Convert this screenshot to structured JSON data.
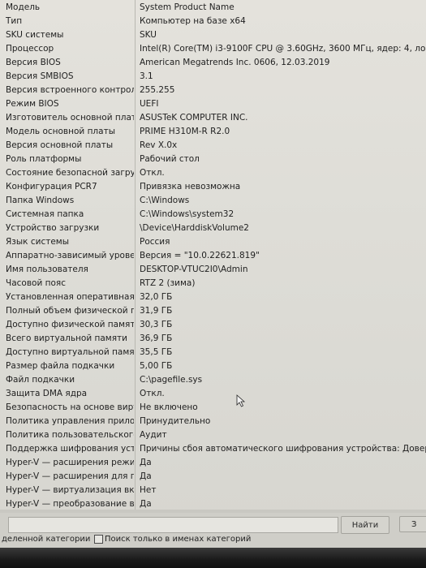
{
  "rows": [
    {
      "name": "Модель",
      "value": "System Product Name"
    },
    {
      "name": "Тип",
      "value": "Компьютер на базе x64"
    },
    {
      "name": "SKU системы",
      "value": "SKU"
    },
    {
      "name": "Процессор",
      "value": "Intel(R) Core(TM) i3-9100F CPU @ 3.60GHz, 3600 МГц, ядер: 4, логических"
    },
    {
      "name": "Версия BIOS",
      "value": "American Megatrends Inc. 0606, 12.03.2019"
    },
    {
      "name": "Версия SMBIOS",
      "value": "3.1"
    },
    {
      "name": "Версия встроенного контролл...",
      "value": "255.255"
    },
    {
      "name": "Режим BIOS",
      "value": "UEFI"
    },
    {
      "name": "Изготовитель основной платы",
      "value": "ASUSTeK COMPUTER INC."
    },
    {
      "name": "Модель основной платы",
      "value": "PRIME H310M-R R2.0"
    },
    {
      "name": "Версия основной платы",
      "value": "Rev X.0x"
    },
    {
      "name": "Роль платформы",
      "value": "Рабочий стол"
    },
    {
      "name": "Состояние безопасной загруз...",
      "value": "Откл."
    },
    {
      "name": "Конфигурация PCR7",
      "value": "Привязка невозможна"
    },
    {
      "name": "Папка Windows",
      "value": "C:\\Windows"
    },
    {
      "name": "Системная папка",
      "value": "C:\\Windows\\system32"
    },
    {
      "name": "Устройство загрузки",
      "value": "\\Device\\HarddiskVolume2"
    },
    {
      "name": "Язык системы",
      "value": "Россия"
    },
    {
      "name": "Аппаратно-зависимый уровен...",
      "value": "Версия = \"10.0.22621.819\""
    },
    {
      "name": "Имя пользователя",
      "value": "DESKTOP-VTUC2I0\\Admin"
    },
    {
      "name": "Часовой пояс",
      "value": "RTZ 2 (зима)"
    },
    {
      "name": "Установленная оперативная п...",
      "value": "32,0 ГБ"
    },
    {
      "name": "Полный объем физической па...",
      "value": "31,9 ГБ"
    },
    {
      "name": "Доступно физической памяти",
      "value": "30,3 ГБ"
    },
    {
      "name": "Всего виртуальной памяти",
      "value": "36,9 ГБ"
    },
    {
      "name": "Доступно виртуальной памяти",
      "value": "35,5 ГБ"
    },
    {
      "name": "Размер файла подкачки",
      "value": "5,00 ГБ"
    },
    {
      "name": "Файл подкачки",
      "value": "C:\\pagefile.sys"
    },
    {
      "name": "Защита DMA ядра",
      "value": "Откл."
    },
    {
      "name": "Безопасность на основе вирту...",
      "value": "Не включено"
    },
    {
      "name": "Политика управления прилож...",
      "value": "Принудительно"
    },
    {
      "name": "Политика пользовательского ...",
      "value": "Аудит"
    },
    {
      "name": "Поддержка шифрования устр...",
      "value": "Причины сбоя автоматического шифрования устройства: Доверенный пла"
    },
    {
      "name": "Hyper-V — расширения режи...",
      "value": "Да"
    },
    {
      "name": "Hyper-V — расширения для п...",
      "value": "Да"
    },
    {
      "name": "Hyper-V — виртуализация вкл...",
      "value": "Нет"
    },
    {
      "name": "Hyper-V — преобразование в...",
      "value": "Да"
    }
  ],
  "footer": {
    "find_label": "Найти",
    "close_label": "З",
    "selected_category_label": "деленной категории",
    "search_names_only_label": "Поиск только в именах категорий",
    "search_names_only_checked": false
  },
  "icons": {
    "cursor": "mouse-pointer-icon"
  }
}
